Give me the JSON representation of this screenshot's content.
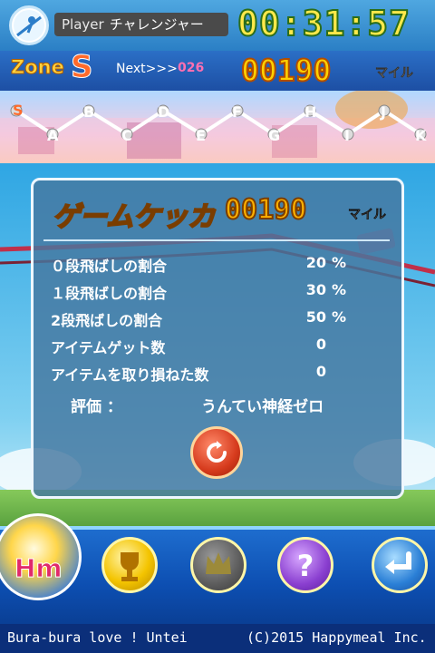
{
  "header": {
    "player_label": "Player",
    "player_name": "チャレンジャー",
    "timer": "00:31:57"
  },
  "zone": {
    "label": "Zone",
    "value": "S",
    "next_label": "Next>>>",
    "next_value": "026",
    "distance": "00190",
    "unit": "マイル"
  },
  "track": {
    "upper_letters": [
      "S",
      "B",
      "D",
      "F",
      "H",
      "J"
    ],
    "lower_letters": [
      "A",
      "C",
      "E",
      "G",
      "I",
      "K"
    ]
  },
  "result": {
    "title": "ゲームケッカ",
    "distance": "00190",
    "unit": "マイル",
    "stats": [
      {
        "label": "０段飛ばしの割合",
        "value": "20",
        "unit": "%"
      },
      {
        "label": "１段飛ばしの割合",
        "value": "30",
        "unit": "%"
      },
      {
        "label": "2段飛ばしの割合",
        "value": "50",
        "unit": "%"
      },
      {
        "label": "アイテムゲット数",
        "value": "0",
        "unit": ""
      },
      {
        "label": "アイテムを取り損ねた数",
        "value": "0",
        "unit": ""
      }
    ],
    "rating_label": "評価 ：",
    "rating_value": "うんてい神経ゼロ"
  },
  "nav": {
    "logo": "Hm",
    "buttons": [
      {
        "icon": "trophy-icon",
        "color": "#f4c400"
      },
      {
        "icon": "crown-icon",
        "color": "#6b6b6b"
      },
      {
        "icon": "question-icon",
        "color": "#8a3fd0"
      },
      {
        "icon": "back-arrow-icon",
        "color": "#2a7fd6"
      }
    ]
  },
  "footer": {
    "title": "Bura-bura love ! Untei",
    "copyright": "(C)2015 Happymeal Inc."
  }
}
